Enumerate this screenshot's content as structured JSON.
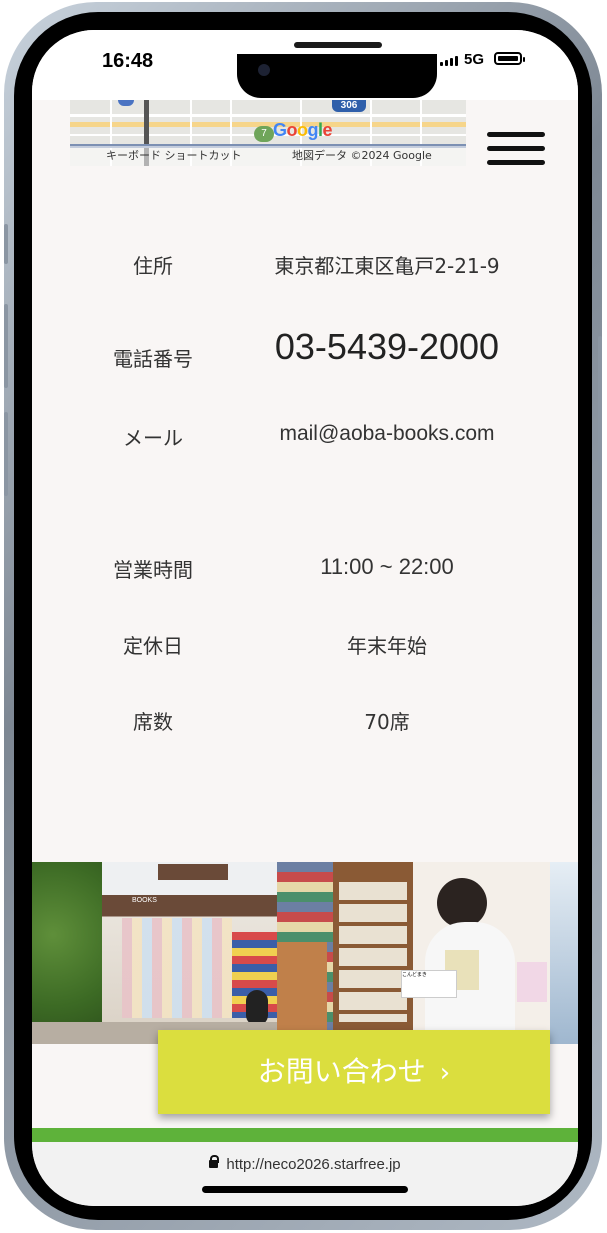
{
  "status_bar": {
    "time": "16:48",
    "network": "5G"
  },
  "map": {
    "shortcut_label": "キーボード ショートカット",
    "attribution": "地図データ ©2024 Google",
    "route_sign": "306",
    "route_badge": "7",
    "logo_text": "Google"
  },
  "info": [
    {
      "label": "住所",
      "value": "東京都江東区亀戸2-21-9"
    },
    {
      "label": "電話番号",
      "value": "03-5439-2000"
    },
    {
      "label": "メール",
      "value": "mail@aoba-books.com"
    },
    {
      "label": "営業時間",
      "value": "11:00 ~ 22:00"
    },
    {
      "label": "定休日",
      "value": "年末年始"
    },
    {
      "label": "席数",
      "value": "70席"
    }
  ],
  "photos": {
    "storefront_sign": "BOOKS",
    "book_sign": "こんどまき"
  },
  "cta": {
    "label": "お問い合わせ",
    "chevron": "›"
  },
  "browser": {
    "url": "http://neco2026.starfree.jp"
  },
  "colors": {
    "accent": "#dbde3e",
    "green_bar": "#5eb23a",
    "background": "#f9f6f5"
  }
}
